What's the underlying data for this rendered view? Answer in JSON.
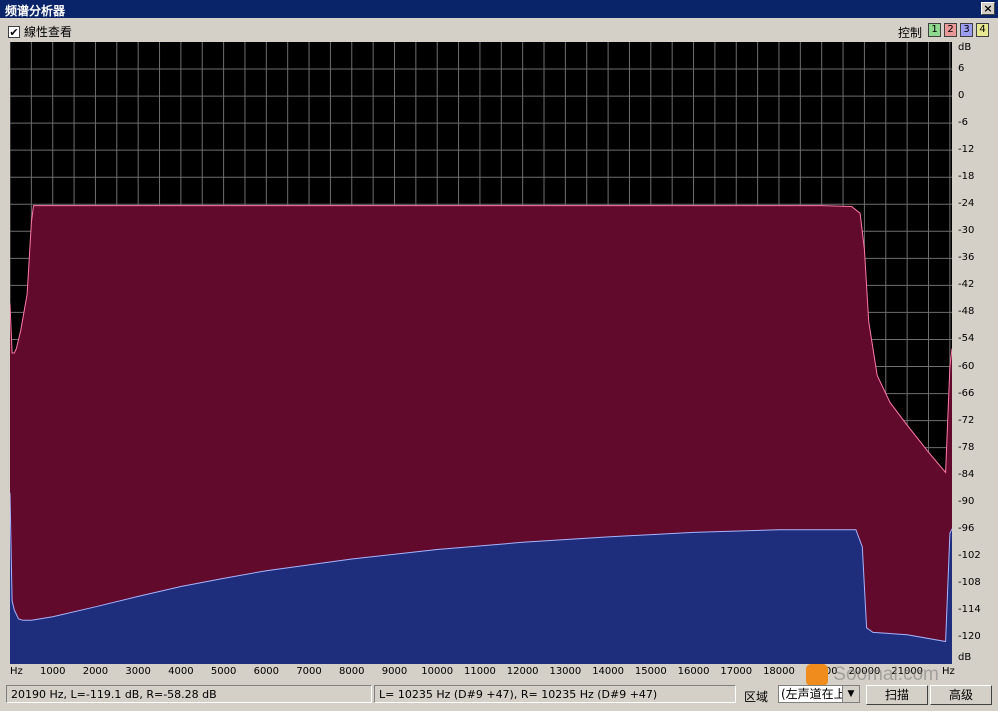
{
  "window": {
    "title": "频谱分析器",
    "close": "×"
  },
  "toolbar": {
    "linear_view_label": "線性查看",
    "linear_view_checked": true,
    "control_label": "控制",
    "channels": [
      {
        "label": "1",
        "color": "#8fd88f"
      },
      {
        "label": "2",
        "color": "#e99898"
      },
      {
        "label": "3",
        "color": "#9c9cf0"
      },
      {
        "label": "4",
        "color": "#e8e890"
      }
    ]
  },
  "colors": {
    "background": "#000000",
    "grid": "#6e6e6e",
    "right_fill": "#620a2c",
    "right_edge": "#ff7aa8",
    "left_fill": "#1f2e7c",
    "left_edge": "#a6b4ff"
  },
  "chart_data": {
    "type": "area",
    "xlabel": "Hz",
    "ylabel": "dB",
    "xlim": [
      0,
      22050
    ],
    "ylim": [
      -126,
      12
    ],
    "x_ticks": [
      "1000",
      "2000",
      "3000",
      "4000",
      "5000",
      "6000",
      "7000",
      "8000",
      "9000",
      "10000",
      "11000",
      "12000",
      "13000",
      "14000",
      "15000",
      "16000",
      "17000",
      "18000",
      "19000",
      "20000",
      "21000"
    ],
    "y_ticks": [
      "dB",
      "6",
      "0",
      "-6",
      "-12",
      "-18",
      "-24",
      "-30",
      "-36",
      "-42",
      "-48",
      "-54",
      "-60",
      "-66",
      "-72",
      "-78",
      "-84",
      "-90",
      "-96",
      "-102",
      "-108",
      "-114",
      "-120",
      "dB"
    ],
    "series": [
      {
        "x": [
          0,
          50,
          100,
          150,
          250,
          400,
          500,
          550,
          700,
          1000,
          5000,
          10000,
          15000,
          19000,
          19700,
          19900,
          20000,
          20100,
          20300,
          20600,
          21000,
          21500,
          21900,
          22000,
          22050
        ],
        "y": [
          -46,
          -57,
          -57,
          -56,
          -52,
          -44,
          -28,
          -24.3,
          -24.3,
          -24.3,
          -24.3,
          -24.3,
          -24.3,
          -24.3,
          -24.5,
          -26,
          -34,
          -50,
          -62,
          -68,
          -73,
          -79,
          -83.5,
          -60,
          -56
        ]
      },
      {
        "x": [
          0,
          50,
          100,
          200,
          300,
          500,
          1000,
          2000,
          3000,
          4000,
          5000,
          6000,
          8000,
          10000,
          12000,
          14000,
          16000,
          18000,
          19800,
          19950,
          20050,
          20200,
          21000,
          21900,
          22000,
          22050
        ],
        "y": [
          -88,
          -112,
          -114,
          -116,
          -116.3,
          -116.3,
          -115.5,
          -113.3,
          -111,
          -108.8,
          -107,
          -105.3,
          -102.7,
          -100.6,
          -99,
          -97.8,
          -96.8,
          -96.2,
          -96.2,
          -100,
          -118,
          -119,
          -119.5,
          -121,
          -97,
          -96
        ]
      }
    ]
  },
  "status": {
    "cursor_readout": "20190 Hz, L=-119.1 dB, R=-58.28 dB",
    "peak_readout": "L=  10235 Hz (D#9 +47), R=  10235 Hz (D#9 +47)",
    "range_label": "区域",
    "range_value": "(左声道在上",
    "scan_button": "扫描",
    "advanced_button": "高级"
  },
  "watermark": {
    "text": "Soomal.com"
  }
}
